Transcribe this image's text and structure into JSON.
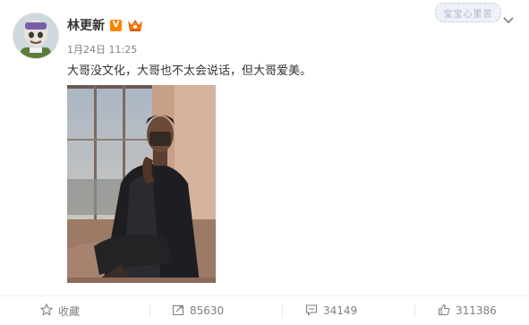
{
  "post": {
    "username": "林更新",
    "vip_badge": "V",
    "timestamp": "1月24日 11:25",
    "text": "大哥没文化，大哥也不太会说话，但大哥爱美。",
    "watermark": "宝宝心里苦",
    "menu_icon": "chevron-down-icon"
  },
  "actions": {
    "favorite": {
      "label": "收藏",
      "icon": "star-icon"
    },
    "repost": {
      "count": "85630",
      "icon": "repost-icon"
    },
    "comment": {
      "count": "34149",
      "icon": "comment-icon"
    },
    "like": {
      "count": "311386",
      "icon": "thumbs-up-icon"
    }
  },
  "colors": {
    "vip_orange": "#ff8200",
    "text": "#333333",
    "meta_gray": "#808080"
  }
}
